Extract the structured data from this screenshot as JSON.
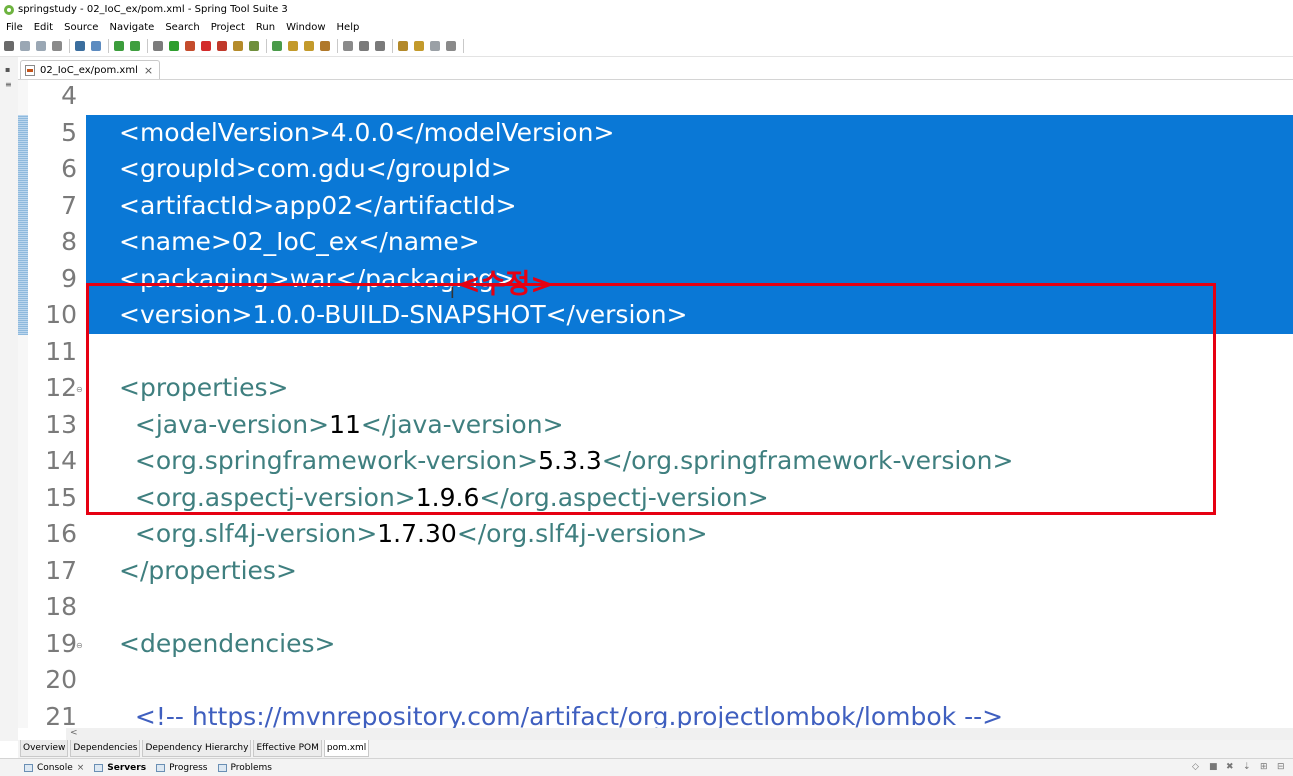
{
  "window": {
    "title": "springstudy - 02_IoC_ex/pom.xml - Spring Tool Suite 3"
  },
  "menu": [
    "File",
    "Edit",
    "Source",
    "Navigate",
    "Search",
    "Project",
    "Run",
    "Window",
    "Help"
  ],
  "toolbar_icons": [
    {
      "name": "new-icon",
      "color": "#6a6a6a"
    },
    {
      "name": "save-icon",
      "color": "#9aa7b4"
    },
    {
      "name": "save-all-icon",
      "color": "#9aa7b4"
    },
    {
      "name": "print-icon",
      "color": "#8a8a8a"
    },
    {
      "name": "console-icon",
      "color": "#3b6e9e"
    },
    {
      "name": "toggle-highlight-icon",
      "color": "#5c8bc0"
    },
    {
      "name": "spring-boot-icon",
      "color": "#3c9d3c"
    },
    {
      "name": "refresh-icon",
      "color": "#3f9f3f"
    },
    {
      "name": "debug-icon",
      "color": "#7c7c7c"
    },
    {
      "name": "run-icon",
      "color": "#2e9e2e"
    },
    {
      "name": "run-external-icon",
      "color": "#c44c2c"
    },
    {
      "name": "stop-icon",
      "color": "#d32b2b"
    },
    {
      "name": "server-icon",
      "color": "#c0392b"
    },
    {
      "name": "new-package-icon",
      "color": "#b58b2a"
    },
    {
      "name": "new-class-icon",
      "color": "#6f8f3c"
    },
    {
      "name": "new-spring-icon",
      "color": "#4a9b4a"
    },
    {
      "name": "open-type-icon",
      "color": "#c39a2b"
    },
    {
      "name": "open-task-icon",
      "color": "#c39a2b"
    },
    {
      "name": "search-icon",
      "color": "#b0782a"
    },
    {
      "name": "annotation-icon",
      "color": "#8a8a8a"
    },
    {
      "name": "next-annotation-icon",
      "color": "#7a7a7a"
    },
    {
      "name": "prev-annotation-icon",
      "color": "#7a7a7a"
    },
    {
      "name": "last-edit-icon",
      "color": "#b3892a"
    },
    {
      "name": "back-icon",
      "color": "#c39a2b"
    },
    {
      "name": "forward-icon",
      "color": "#9aa0a6"
    },
    {
      "name": "pin-editor-icon",
      "color": "#8a8a8a"
    }
  ],
  "editor_tab": {
    "label": "02_IoC_ex/pom.xml",
    "close": "×"
  },
  "code_lines": [
    {
      "num": "4",
      "tag": "",
      "value": "",
      "close": "",
      "selected": false,
      "fold": ""
    },
    {
      "num": "5",
      "tag": "<modelVersion>",
      "value": "4.0.0",
      "close": "</modelVersion>",
      "selected": true,
      "fold": ""
    },
    {
      "num": "6",
      "tag": "<groupId>",
      "value": "com.gdu",
      "close": "</groupId>",
      "selected": true,
      "fold": ""
    },
    {
      "num": "7",
      "tag": "<artifactId>",
      "value": "app02",
      "close": "</artifactId>",
      "selected": true,
      "fold": ""
    },
    {
      "num": "8",
      "tag": "<name>",
      "value": "02_IoC_ex",
      "close": "</name>",
      "selected": true,
      "fold": ""
    },
    {
      "num": "9",
      "tag": "<packaging>",
      "value": "war",
      "close": "</packaging>",
      "selected": true,
      "fold": ""
    },
    {
      "num": "10",
      "tag": "<version>",
      "value": "1.0.0-BUILD-SNAPSHOT",
      "close": "</version>",
      "selected": true,
      "fold": ""
    },
    {
      "num": "11",
      "tag": "",
      "value": "",
      "close": "",
      "selected": false,
      "fold": ""
    },
    {
      "num": "12",
      "tag": "<properties>",
      "value": "",
      "close": "",
      "selected": false,
      "fold": "⊖"
    },
    {
      "num": "13",
      "tag": "  <java-version>",
      "value": "11",
      "close": "</java-version>",
      "selected": false,
      "fold": ""
    },
    {
      "num": "14",
      "tag": "  <org.springframework-version>",
      "value": "5.3.3",
      "close": "</org.springframework-version>",
      "selected": false,
      "fold": ""
    },
    {
      "num": "15",
      "tag": "  <org.aspectj-version>",
      "value": "1.9.6",
      "close": "</org.aspectj-version>",
      "selected": false,
      "fold": ""
    },
    {
      "num": "16",
      "tag": "  <org.slf4j-version>",
      "value": "1.7.30",
      "close": "</org.slf4j-version>",
      "selected": false,
      "fold": ""
    },
    {
      "num": "17",
      "tag": "</properties>",
      "value": "",
      "close": "",
      "selected": false,
      "fold": ""
    },
    {
      "num": "18",
      "tag": "",
      "value": "",
      "close": "",
      "selected": false,
      "fold": ""
    },
    {
      "num": "19",
      "tag": "<dependencies>",
      "value": "",
      "close": "",
      "selected": false,
      "fold": "⊖"
    },
    {
      "num": "20",
      "tag": "",
      "value": "",
      "close": "",
      "selected": false,
      "fold": ""
    },
    {
      "num": "21",
      "tag": "  ",
      "value": "",
      "close": "<!-- https://mvnrepository.com/artifact/org.projectlombok/lombok -->",
      "selected": false,
      "fold": "",
      "comment": true
    }
  ],
  "annotation": {
    "label": "<수정>",
    "color": "#e60012"
  },
  "scroll_left_glyph": "<",
  "pom_tabs": [
    "Overview",
    "Dependencies",
    "Dependency Hierarchy",
    "Effective POM",
    "pom.xml"
  ],
  "active_pom_tab": "pom.xml",
  "bottom_views": [
    {
      "label": "Console",
      "closable": true,
      "bold": false
    },
    {
      "label": "Servers",
      "closable": false,
      "bold": true
    },
    {
      "label": "Progress",
      "closable": false,
      "bold": false
    },
    {
      "label": "Problems",
      "closable": false,
      "bold": false
    }
  ],
  "colors": {
    "selection": "#0a78d6",
    "tag": "#3f7f7f",
    "comment": "#3f5fbf"
  }
}
